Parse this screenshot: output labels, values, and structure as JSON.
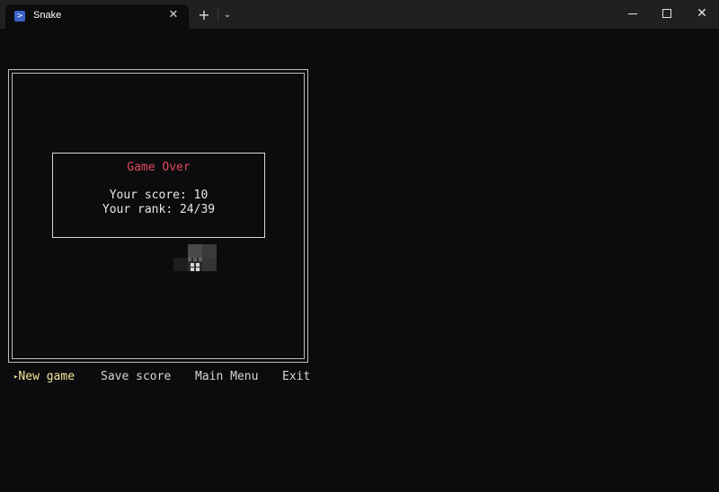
{
  "window": {
    "tab_title": "Snake",
    "tab_icon": "terminal-icon",
    "close_tab_glyph": "✕",
    "new_tab_glyph": "+",
    "dropdown_glyph": "⌄",
    "close_window_glyph": "✕"
  },
  "game_over": {
    "title": "Game Over",
    "score_line": "Your score: 10",
    "rank_line": "Your rank: 24/39"
  },
  "menu": {
    "selected_marker": "▸",
    "items": [
      "New game",
      "Save score",
      "Main Menu",
      "Exit"
    ],
    "selected_index": 0
  },
  "colors": {
    "background": "#0c0c0e",
    "title_red": "#e0485c",
    "selected_yellow": "#f3e69a",
    "text": "#d6d6d6"
  }
}
